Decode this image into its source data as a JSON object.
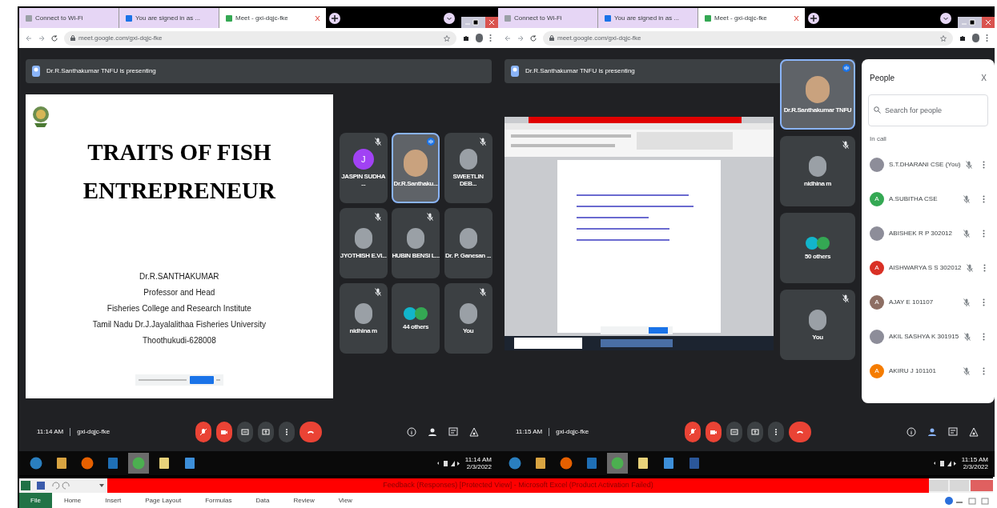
{
  "left_window": {
    "tabs": [
      {
        "label": "Connect to Wi-Fi",
        "selected": false
      },
      {
        "label": "You are signed in as ...",
        "selected": false
      },
      {
        "label": "Meet - gxi-dqjc-fke",
        "selected": true
      }
    ],
    "url": "meet.google.com/gxi-dqjc-fke",
    "banner": "Dr.R.Santhakumar TNFU is presenting",
    "slide": {
      "title_lines": [
        "TRAITS OF FISH",
        "ENTREPRENEUR"
      ],
      "lines": [
        "Dr.R.SANTHAKUMAR",
        "Professor and Head",
        "Fisheries College and Research Institute",
        "Tamil Nadu Dr.J.Jayalalithaa Fisheries University",
        "Thoothukudi-628008"
      ]
    },
    "tiles": [
      {
        "name": "JASPIN SUDHA ...",
        "kind": "letter",
        "initial": "J",
        "color": "#a142f4",
        "muted": true,
        "speaking": false
      },
      {
        "name": "Dr.R.Santhaku...",
        "kind": "video",
        "muted": false,
        "speaking": true
      },
      {
        "name": "SWEETLIN DEB...",
        "kind": "photo",
        "muted": true,
        "speaking": false
      },
      {
        "name": "JYOTHISH E.VI...",
        "kind": "photo",
        "muted": true,
        "speaking": false
      },
      {
        "name": "HUBIN BENSI L...",
        "kind": "photo",
        "muted": true,
        "speaking": false
      },
      {
        "name": "Dr. P. Ganesan ...",
        "kind": "photo",
        "muted": false,
        "speaking": false
      },
      {
        "name": "nidhina m",
        "kind": "photo",
        "muted": true,
        "speaking": false
      },
      {
        "name": "44 others",
        "kind": "group",
        "muted": false,
        "speaking": false
      },
      {
        "name": "You",
        "kind": "photo",
        "muted": true,
        "speaking": false
      }
    ],
    "time": "11:14 AM",
    "code": "gxi-dqjc-fke",
    "controls": [
      {
        "kind": "mic",
        "muted": true
      },
      {
        "kind": "camera",
        "muted": true
      },
      {
        "kind": "captions",
        "muted": false
      },
      {
        "kind": "present",
        "muted": false
      },
      {
        "kind": "more",
        "muted": false
      },
      {
        "kind": "leave"
      }
    ],
    "side_buttons": [
      {
        "kind": "info",
        "selected": false
      },
      {
        "kind": "people",
        "selected": false
      },
      {
        "kind": "chat",
        "selected": false
      },
      {
        "kind": "activities",
        "selected": false
      }
    ],
    "taskbar": [
      {
        "kind": "start",
        "selected": false
      },
      {
        "kind": "media",
        "selected": false
      },
      {
        "kind": "firefox",
        "selected": false
      },
      {
        "kind": "publisher",
        "selected": false
      },
      {
        "kind": "chrome",
        "selected": true
      },
      {
        "kind": "files",
        "selected": false
      },
      {
        "kind": "ie",
        "selected": false
      }
    ],
    "clock": {
      "time": "11:14 AM",
      "date": "2/3/2022"
    }
  },
  "right_window": {
    "tabs": [
      {
        "label": "Connect to Wi-Fi",
        "selected": false
      },
      {
        "label": "You are signed in as ...",
        "selected": false
      },
      {
        "label": "Meet - gxi-dqjc-fke",
        "selected": true
      }
    ],
    "url": "meet.google.com/gxi-dqjc-fke",
    "banner": "Dr.R.Santhakumar TNFU is presenting",
    "tiles": [
      {
        "name": "Dr.R.Santhakumar TNFU",
        "kind": "video",
        "muted": false,
        "speaking": true
      },
      {
        "name": "nidhina m",
        "kind": "photo",
        "muted": true,
        "speaking": false
      },
      {
        "name": "50 others",
        "kind": "group",
        "muted": false,
        "speaking": false
      },
      {
        "name": "You",
        "kind": "photo",
        "muted": true,
        "speaking": false
      }
    ],
    "people": {
      "title": "People",
      "close": "X",
      "placeholder": "Search for people",
      "section": "In call",
      "members": [
        {
          "name": "S.T.DHARANI CSE (You)",
          "kind": "photo"
        },
        {
          "name": "A.SUBITHA CSE",
          "kind": "letter",
          "initial": "A",
          "color": "#34a853"
        },
        {
          "name": "ABISHEK R P 302012",
          "kind": "photo"
        },
        {
          "name": "AISHWARYA S S 302012",
          "kind": "letter",
          "initial": "A",
          "color": "#d93025"
        },
        {
          "name": "AJAY E 101107",
          "kind": "letter",
          "initial": "A",
          "color": "#8d6e63"
        },
        {
          "name": "AKIL SASHYA K 301915",
          "kind": "photo"
        },
        {
          "name": "AKIRU J 101101",
          "kind": "letter",
          "initial": "A",
          "color": "#f57c00"
        }
      ]
    },
    "time": "11:15 AM",
    "code": "gxi-dqjc-fke",
    "controls": [
      {
        "kind": "mic",
        "muted": true
      },
      {
        "kind": "camera",
        "muted": true
      },
      {
        "kind": "captions",
        "muted": false
      },
      {
        "kind": "present",
        "muted": false
      },
      {
        "kind": "more",
        "muted": false
      },
      {
        "kind": "leave"
      }
    ],
    "side_buttons": [
      {
        "kind": "info",
        "selected": false
      },
      {
        "kind": "people",
        "selected": true
      },
      {
        "kind": "chat",
        "selected": false
      },
      {
        "kind": "activities",
        "selected": false
      }
    ],
    "taskbar": [
      {
        "kind": "start",
        "selected": false
      },
      {
        "kind": "media",
        "selected": false
      },
      {
        "kind": "firefox",
        "selected": false
      },
      {
        "kind": "publisher",
        "selected": false
      },
      {
        "kind": "chrome",
        "selected": true
      },
      {
        "kind": "files",
        "selected": false
      },
      {
        "kind": "ie",
        "selected": false
      },
      {
        "kind": "word",
        "selected": false
      }
    ],
    "clock": {
      "time": "11:15 AM",
      "date": "2/3/2022"
    }
  },
  "excel": {
    "title": "Feedback (Responses)  [Protected View]  -  Microsoft Excel (Product Activation Failed)",
    "tabs": [
      {
        "label": "File",
        "selected": true
      },
      {
        "label": "Home",
        "selected": false
      },
      {
        "label": "Insert",
        "selected": false
      },
      {
        "label": "Page Layout",
        "selected": false
      },
      {
        "label": "Formulas",
        "selected": false
      },
      {
        "label": "Data",
        "selected": false
      },
      {
        "label": "Review",
        "selected": false
      },
      {
        "label": "View",
        "selected": false
      }
    ]
  }
}
